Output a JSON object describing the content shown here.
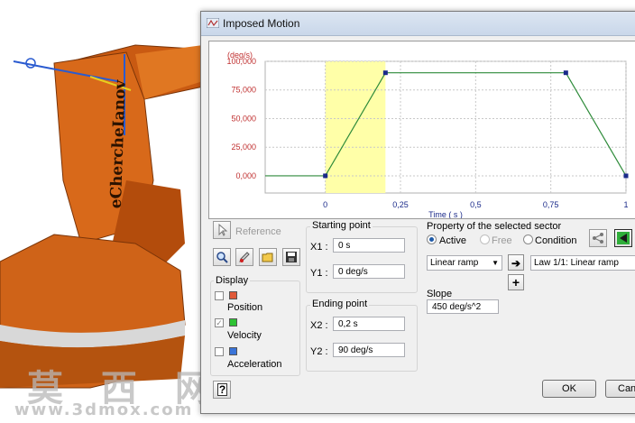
{
  "background": {
    "robot_label": "eChercheIanov",
    "watermark_cn": "莫 西 网",
    "watermark_url": "www.3dmox.com"
  },
  "dialog": {
    "title": "Imposed Motion",
    "chart": {
      "y_unit": "(deg/s)",
      "x_title": "Time ( s )",
      "y_ticks": [
        "100,000",
        "75,000",
        "50,000",
        "25,000",
        "0,000"
      ],
      "x_ticks": [
        "0",
        "0,25",
        "0,5",
        "0,75",
        "1"
      ]
    },
    "toolbar": {
      "reference_label": "Reference"
    },
    "display": {
      "label": "Display",
      "items": [
        {
          "label": "Position",
          "checked": false,
          "color": "#e05a3a"
        },
        {
          "label": "Velocity",
          "checked": true,
          "color": "#2ec234"
        },
        {
          "label": "Acceleration",
          "checked": false,
          "color": "#3a74d8"
        }
      ]
    },
    "starting_point": {
      "label": "Starting point",
      "x1_label": "X1 :",
      "x1_value": "0 s",
      "y1_label": "Y1 :",
      "y1_value": "0 deg/s"
    },
    "ending_point": {
      "label": "Ending point",
      "x2_label": "X2 :",
      "x2_value": "0,2 s",
      "y2_label": "Y2 :",
      "y2_value": "90 deg/s"
    },
    "property": {
      "label": "Property of the selected sector",
      "radios": [
        {
          "label": "Active",
          "selected": true,
          "enabled": true
        },
        {
          "label": "Free",
          "selected": false,
          "enabled": false
        },
        {
          "label": "Condition",
          "selected": false,
          "enabled": true
        }
      ],
      "ramp_type": "Linear ramp",
      "law": "Law 1/1: Linear ramp",
      "slope_label": "Slope",
      "slope_value": "450 deg/s^2"
    },
    "buttons": {
      "ok": "OK",
      "cancel": "Canc",
      "help": "?"
    }
  },
  "chart_data": {
    "type": "line",
    "x": [
      -0.2,
      0,
      0.2,
      0.8,
      1,
      1.2
    ],
    "series": [
      {
        "values": [
          0,
          0,
          90000,
          90000,
          0,
          0
        ],
        "color": "#2e8b3a"
      }
    ],
    "highlight_range": [
      0,
      0.2
    ],
    "xlabel": "Time ( s )",
    "ylabel": "(deg/s)",
    "xlim": [
      -0.2,
      1.0
    ],
    "ylim": [
      -15000,
      100000
    ],
    "x_ticks": [
      0,
      0.25,
      0.5,
      0.75,
      1
    ],
    "y_ticks": [
      0,
      25000,
      50000,
      75000,
      100000
    ],
    "grid": true
  }
}
